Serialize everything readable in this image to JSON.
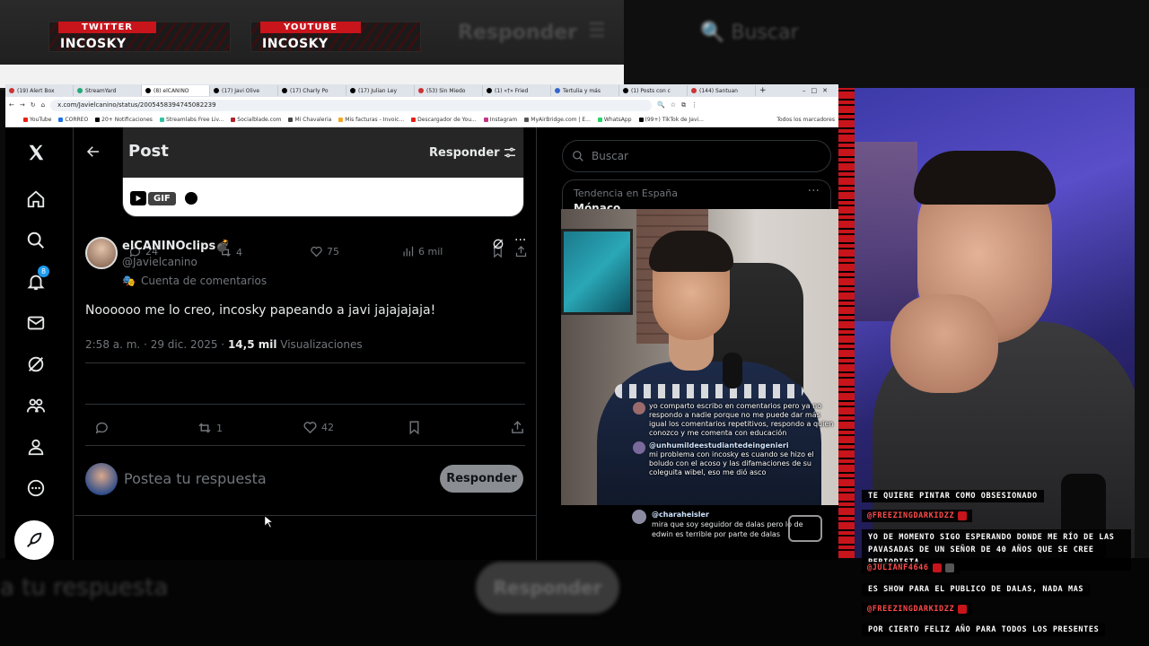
{
  "overlay": {
    "twitter_tag": {
      "label": "TWITTER",
      "name": "INCOSKY"
    },
    "youtube_tag": {
      "label": "YOUTUBE",
      "name": "INCOSKY"
    },
    "ghost_responder": "Responder",
    "ghost_buscar": "Buscar",
    "ghost_reply_btn": "Responder",
    "ghost_reply_text": "a tu respuesta"
  },
  "browser": {
    "tabs": [
      {
        "label": "(19) Alert Box"
      },
      {
        "label": "StreamYard"
      },
      {
        "label": "(8) elCANINO"
      },
      {
        "label": "(17) Javi Olive"
      },
      {
        "label": "(17) Charly Po"
      },
      {
        "label": "(17) Julian Ley"
      },
      {
        "label": "(53) Sin Miedo"
      },
      {
        "label": "(1) «†» Fried"
      },
      {
        "label": "Tertulia y más"
      },
      {
        "label": "(1) Posts con c"
      },
      {
        "label": "(144) Santuan"
      }
    ],
    "url": "x.com/Javielcanino/status/2005458394745082239",
    "bookmarks": [
      {
        "label": "YouTube",
        "color": "#e62117"
      },
      {
        "label": "CORREO",
        "color": "#1a73e8"
      },
      {
        "label": "20+ Notificaciones",
        "color": "#000000"
      },
      {
        "label": "Streamlabs Free Liv...",
        "color": "#31c3a2"
      },
      {
        "label": "Socialblade.com",
        "color": "#b21f2d"
      },
      {
        "label": "Mi Chavaleria",
        "color": "#444444"
      },
      {
        "label": "Mis facturas - Invoic...",
        "color": "#f5a623"
      },
      {
        "label": "Descargador de You...",
        "color": "#e62117"
      },
      {
        "label": "Instagram",
        "color": "#c13584"
      },
      {
        "label": "MyAirBridge.com | E...",
        "color": "#555555"
      },
      {
        "label": "WhatsApp",
        "color": "#25d366"
      },
      {
        "label": "(99+) TikTok de Javi...",
        "color": "#000000"
      }
    ],
    "all_bookmarks": "Todos los marcadores"
  },
  "sidebar": {
    "notif_count": "8"
  },
  "post": {
    "header_title": "Post",
    "header_reply": "Responder",
    "gif_label": "GIF",
    "prev_metrics": {
      "replies": "24",
      "reposts": "4",
      "likes": "75",
      "views": "6 mil"
    },
    "author_name": "elCANINOclips💣",
    "author_handle": "@Javielcanino",
    "parody_label": "Cuenta de comentarios",
    "text": "Noooooo me lo creo, incosky papeando a javi jajajajaja!",
    "time": "2:58 a. m. · 29 dic. 2025 · ",
    "views_count": "14,5 mil",
    "views_label": "Visualizaciones",
    "metrics": {
      "reposts": "1",
      "likes": "42"
    },
    "reply_placeholder": "Postea tu respuesta",
    "reply_button": "Responder"
  },
  "right": {
    "search_placeholder": "Buscar",
    "trend_label": "Tendencia en España",
    "trend_name": "Mónaco",
    "trend_more": "···"
  },
  "video_chat": [
    {
      "user": "",
      "text": "yo comparto escribo en comentarios pero ya no respondo a nadie porque no me puede dar más igual los comentarios repetitivos, respondo a quien conozco y me comenta con educación"
    },
    {
      "user": "@unhumildeestudiantedeingenieri",
      "text": "mi problema con incosky es cuando se hizo el boludo con el acoso y las difamaciones de su coleguita wibel, eso me dió asco"
    }
  ],
  "below_chat": {
    "user": "@charaheisler",
    "text": "mira que soy seguidor de dalas pero lo de edwin es terrible por parte de dalas"
  },
  "stream_chat": [
    {
      "type": "msg",
      "text": "TE QUIERE PINTAR COMO OBSESIONADO"
    },
    {
      "type": "user",
      "text": "@FREEZINGDARKIDZZ"
    },
    {
      "type": "msg",
      "text": "YO DE MOMENTO SIGO ESPERANDO DONDE ME RÍO DE LAS PAVASADAS DE UN SEÑOR DE 40 AÑOS QUE SE CREE PERIODISTA"
    },
    {
      "type": "user",
      "text": "@JULIANF4646"
    },
    {
      "type": "msg",
      "text": "ES SHOW PARA EL PUBLICO DE DALAS, NADA MAS"
    },
    {
      "type": "user",
      "text": "@FREEZINGDARKIDZZ"
    },
    {
      "type": "msg",
      "text": "POR CIERTO FELIZ AÑO PARA TODOS LOS PRESENTES"
    }
  ]
}
